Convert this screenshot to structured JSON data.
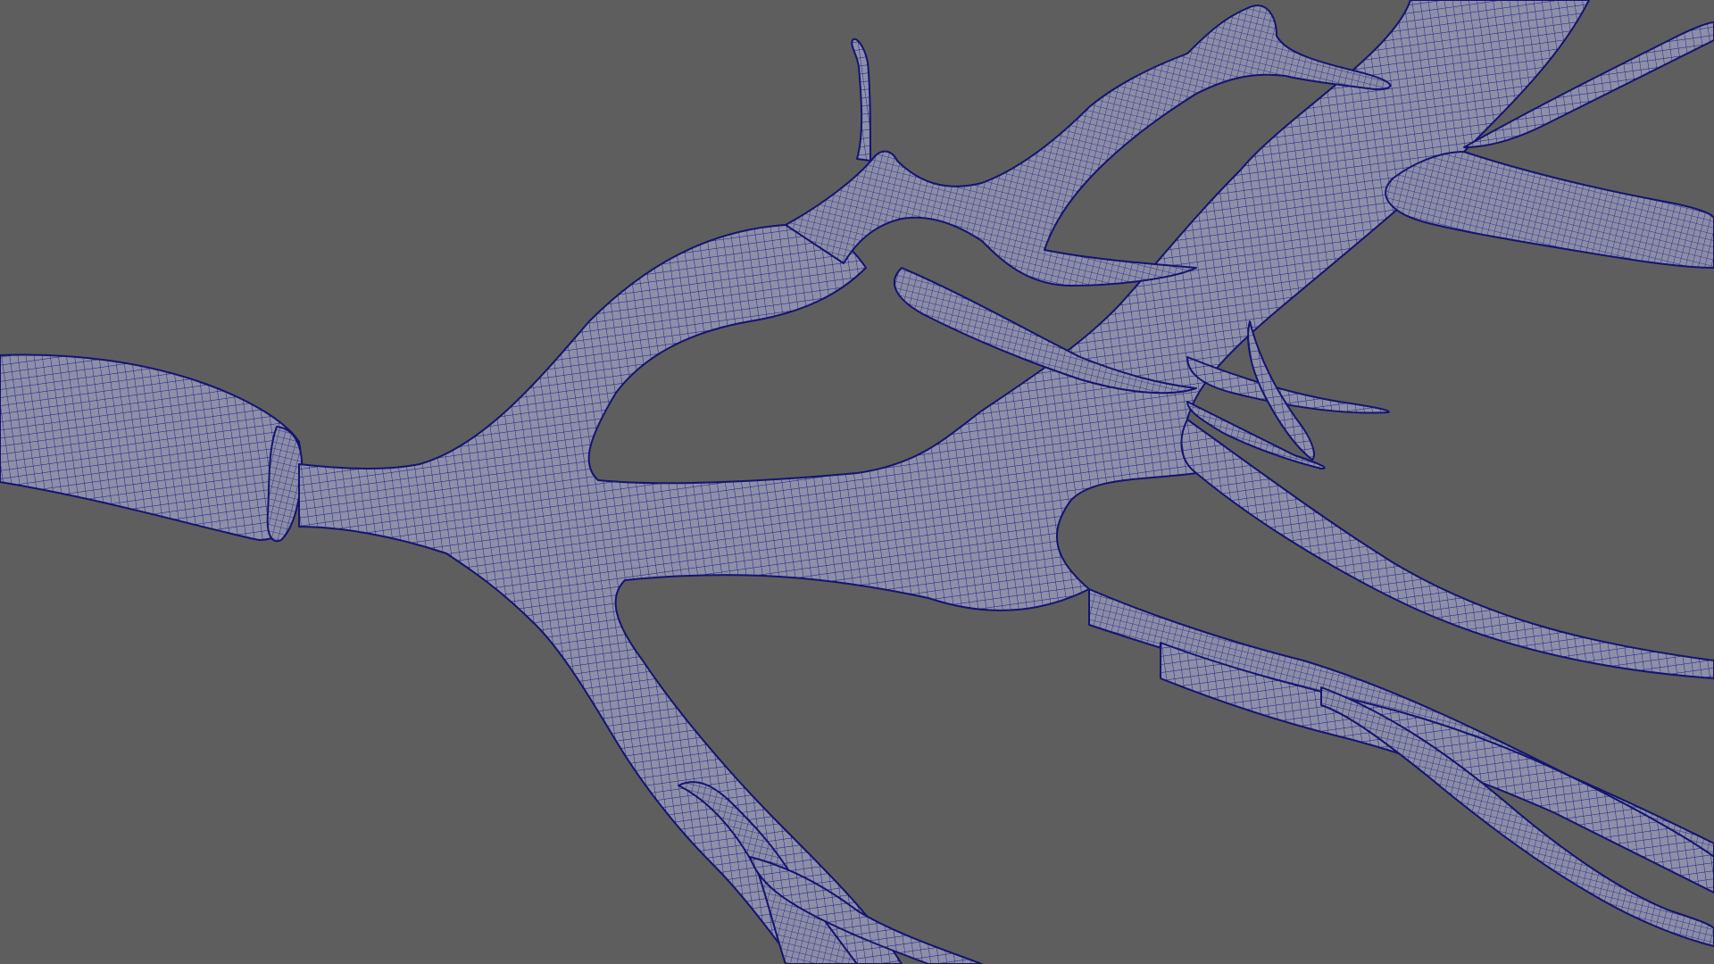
{
  "viewport": {
    "background_color": "#5e5e5e",
    "display_mode": "wireframe-on-shaded",
    "mesh": {
      "name": "",
      "surface_color": "#8e8fa8",
      "wire_color": "#1a1a86"
    }
  }
}
